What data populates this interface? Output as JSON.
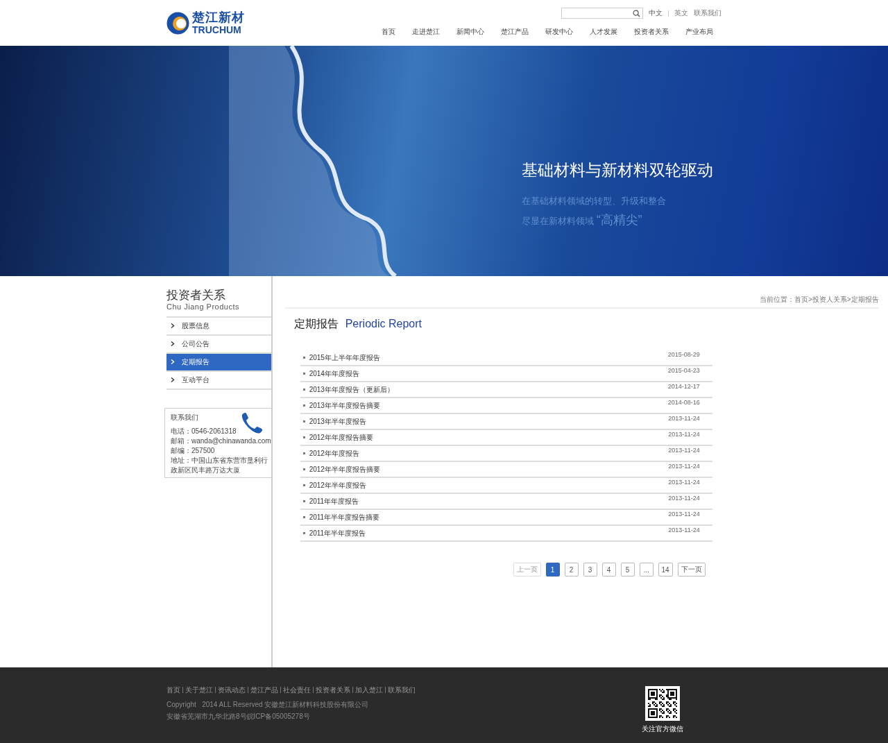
{
  "header": {
    "logo": {
      "name_cn": "楚江新材",
      "name_en": "TRUCHUM"
    },
    "languages": [
      {
        "label": "中文",
        "selected": true
      },
      {
        "label": "英文",
        "selected": false
      }
    ],
    "contact_link": "联系我们",
    "nav": [
      {
        "label": "首页"
      },
      {
        "label": "走进楚江"
      },
      {
        "label": "新闻中心"
      },
      {
        "label": "楚江产品"
      },
      {
        "label": "研发中心"
      },
      {
        "label": "人才发展"
      },
      {
        "label": "投资者关系"
      },
      {
        "label": "产业布局"
      }
    ]
  },
  "banner": {
    "headline": "基础材料与新材料双轮驱动",
    "line_1": "在基础材料领域的转型、升级和整合",
    "line_2_prefix": "尽显在新材料领域",
    "line_2_highlight": "“高精尖”"
  },
  "sidebar": {
    "title": "投资者关系",
    "subtitle": "Chu Jiang Products",
    "items": [
      {
        "label": "股票信息",
        "selected": false
      },
      {
        "label": "公司公告",
        "selected": false
      },
      {
        "label": "定期报告",
        "selected": true
      },
      {
        "label": "互动平台",
        "selected": false
      }
    ],
    "contact": {
      "title": "联系我们",
      "lines": [
        "电话：0546-2061318",
        "邮箱：wanda@chinawanda.com",
        "邮编：257500",
        "地址：中国山东省东营市垦利行政新区民丰路万达大厦"
      ]
    }
  },
  "breadcrumb": "当前位置：首页>投资人关系>定期报告",
  "page_title": {
    "cn": "定期报告",
    "en": "Periodic Report"
  },
  "reports": [
    {
      "title": "2015年上半年年度报告",
      "date": "2015-08-29"
    },
    {
      "title": "2014年年度报告",
      "date": "2015-04-23"
    },
    {
      "title": "2013年年度报告（更新后）",
      "date": "2014-12-17"
    },
    {
      "title": "2013年半年度报告摘要",
      "date": "2014-08-16"
    },
    {
      "title": "2013年半年度报告",
      "date": "2013-11-24"
    },
    {
      "title": "2012年年度报告摘要",
      "date": "2013-11-24"
    },
    {
      "title": "2012年年度报告",
      "date": "2013-11-24"
    },
    {
      "title": "2012年半年度报告摘要",
      "date": "2013-11-24"
    },
    {
      "title": "2012年半年度报告",
      "date": "2013-11-24"
    },
    {
      "title": "2011年年度报告",
      "date": "2013-11-24"
    },
    {
      "title": "2011年半年度报告摘要",
      "date": "2013-11-24"
    },
    {
      "title": "2011年半年度报告",
      "date": "2013-11-24"
    }
  ],
  "pagination": [
    {
      "label": "上一页",
      "selected": false,
      "disabled": true
    },
    {
      "label": "1",
      "selected": true,
      "disabled": false
    },
    {
      "label": "2",
      "selected": false,
      "disabled": false
    },
    {
      "label": "3",
      "selected": false,
      "disabled": false
    },
    {
      "label": "4",
      "selected": false,
      "disabled": false
    },
    {
      "label": "5",
      "selected": false,
      "disabled": false
    },
    {
      "label": "...",
      "selected": false,
      "disabled": false
    },
    {
      "label": "14",
      "selected": false,
      "disabled": false
    },
    {
      "label": "下一页",
      "selected": false,
      "disabled": false
    }
  ],
  "footer": {
    "links": [
      "首页",
      "关于楚江",
      "资讯动态",
      "楚江产品",
      "社会责任",
      "投资者关系",
      "加入楚江",
      "联系我们"
    ],
    "copyright": "Copyright   2014 ALL Reserved 安徽楚江新材料科技股份有限公司",
    "icp": "安徽省芜湖市九华北路8号皖ICP备05005278号",
    "qr_caption": "关注官方微信"
  }
}
